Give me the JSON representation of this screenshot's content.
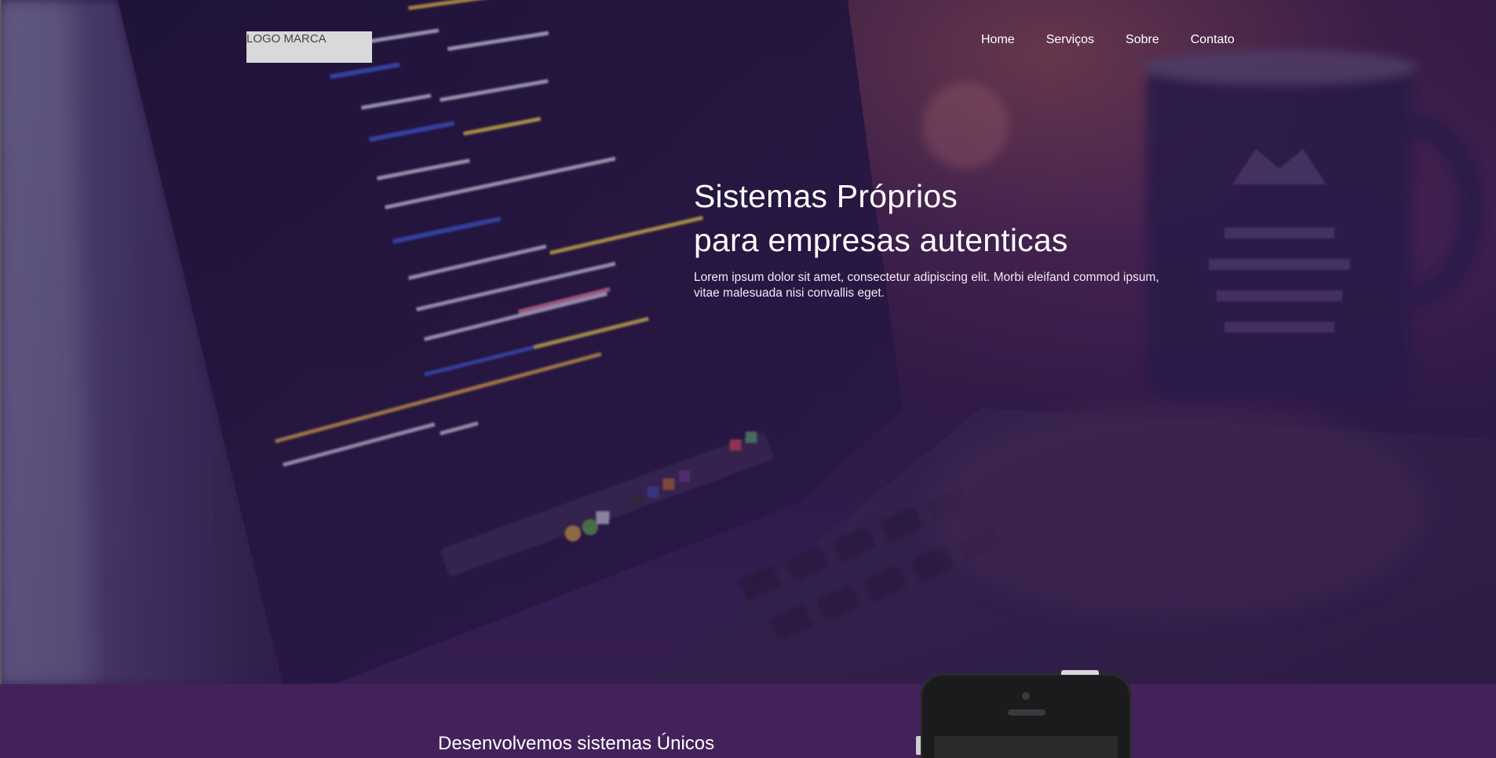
{
  "header": {
    "logo_text": "LOGO MARCA",
    "nav": [
      {
        "label": "Home"
      },
      {
        "label": "Serviços"
      },
      {
        "label": "Sobre"
      },
      {
        "label": "Contato"
      }
    ]
  },
  "hero": {
    "title_line1": "Sistemas Próprios",
    "title_line2": "para empresas autenticas",
    "description": "Lorem ipsum dolor sit amet, consectetur adipiscing elit. Morbi eleifand commod ipsum, vitae malesuada nisi convallis eget."
  },
  "section": {
    "title": "Desenvolvemos sistemas Únicos"
  },
  "colors": {
    "hero_overlay": "#2a1740",
    "band_background": "#43225b",
    "logo_background": "#d9d9d9"
  }
}
